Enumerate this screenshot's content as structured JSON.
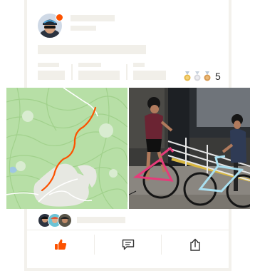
{
  "activity": {
    "medals": {
      "icons": [
        "gold-medal-icon",
        "silver-medal-icon",
        "bronze-medal-icon"
      ],
      "colors": [
        "#e6b84a",
        "#d7d7dc",
        "#d79a52"
      ],
      "count": "5"
    }
  },
  "actions": [
    {
      "icon": "kudos-thumbs-up-icon",
      "color": "#fc5200"
    },
    {
      "icon": "comment-icon",
      "color": "#333333"
    },
    {
      "icon": "share-icon",
      "color": "#333333"
    }
  ],
  "colors": {
    "accent": "#fc5200",
    "placeholder": "#f1efe9",
    "map_green": "#b7dfa6",
    "route": "#fc5200"
  }
}
